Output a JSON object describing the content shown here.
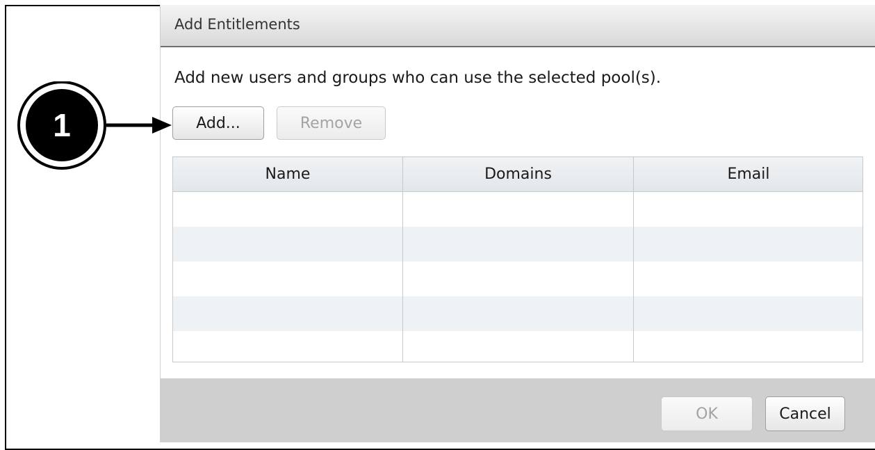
{
  "dialog": {
    "title": "Add Entitlements",
    "description": "Add new users and groups who can use the selected pool(s).",
    "buttons": {
      "add_label": "Add...",
      "remove_label": "Remove"
    },
    "table": {
      "columns": [
        "Name",
        "Domains",
        "Email"
      ],
      "rows": []
    },
    "footer": {
      "ok_label": "OK",
      "cancel_label": "Cancel"
    }
  },
  "callout": {
    "number": "1"
  }
}
